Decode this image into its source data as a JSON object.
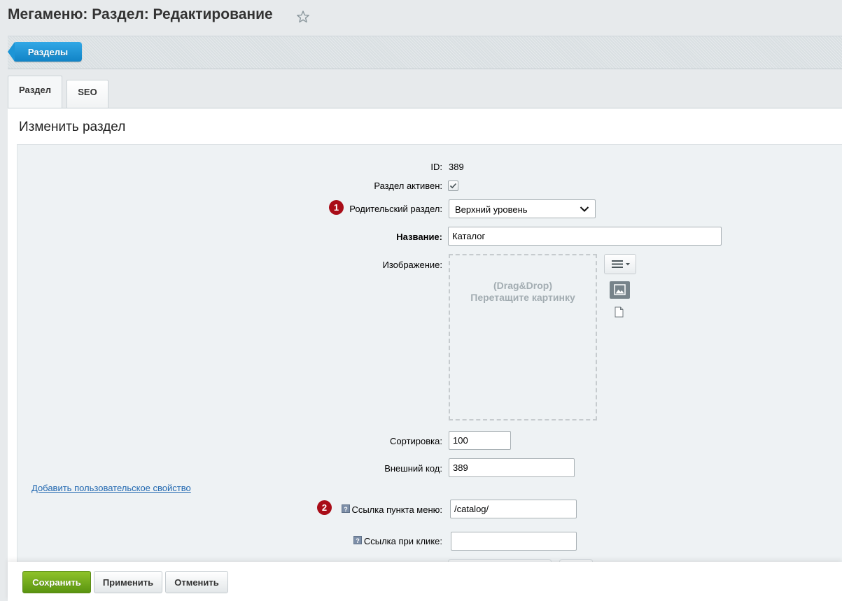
{
  "page": {
    "title": "Мегаменю: Раздел: Редактирование"
  },
  "toolbar": {
    "back_label": "Разделы"
  },
  "tabs": [
    {
      "label": "Раздел",
      "active": true
    },
    {
      "label": "SEO",
      "active": false
    }
  ],
  "section": {
    "title": "Изменить раздел"
  },
  "form": {
    "id_label": "ID:",
    "id_value": "389",
    "active_label": "Раздел активен:",
    "active_checked": true,
    "parent_label": "Родительский раздел:",
    "parent_value": "Верхний уровень",
    "name_label": "Название:",
    "name_value": "Каталог",
    "image_label": "Изображение:",
    "dropzone_line1": "(Drag&Drop)",
    "dropzone_line2": "Перетащите картинку",
    "sort_label": "Сортировка:",
    "sort_value": "100",
    "xml_label": "Внешний код:",
    "xml_value": "389",
    "add_user_prop": "Добавить пользовательское свойство",
    "menu_link_label": "Ссылка пункта меню:",
    "menu_link_value": "/catalog/",
    "click_link_label": "Ссылка при клике:",
    "click_link_value": ""
  },
  "badges": [
    "1",
    "2"
  ],
  "footer": {
    "save": "Сохранить",
    "apply": "Применить",
    "cancel": "Отменить"
  },
  "colors": {
    "accent_blue": "#1d95d6",
    "save_green": "#6ba51a",
    "badge_red": "#a90d18",
    "link_blue": "#2067b0"
  },
  "icons": [
    "star-icon",
    "chevron-down-icon",
    "checkmark-icon",
    "menu-icon",
    "image-icon",
    "document-icon",
    "help-icon"
  ]
}
